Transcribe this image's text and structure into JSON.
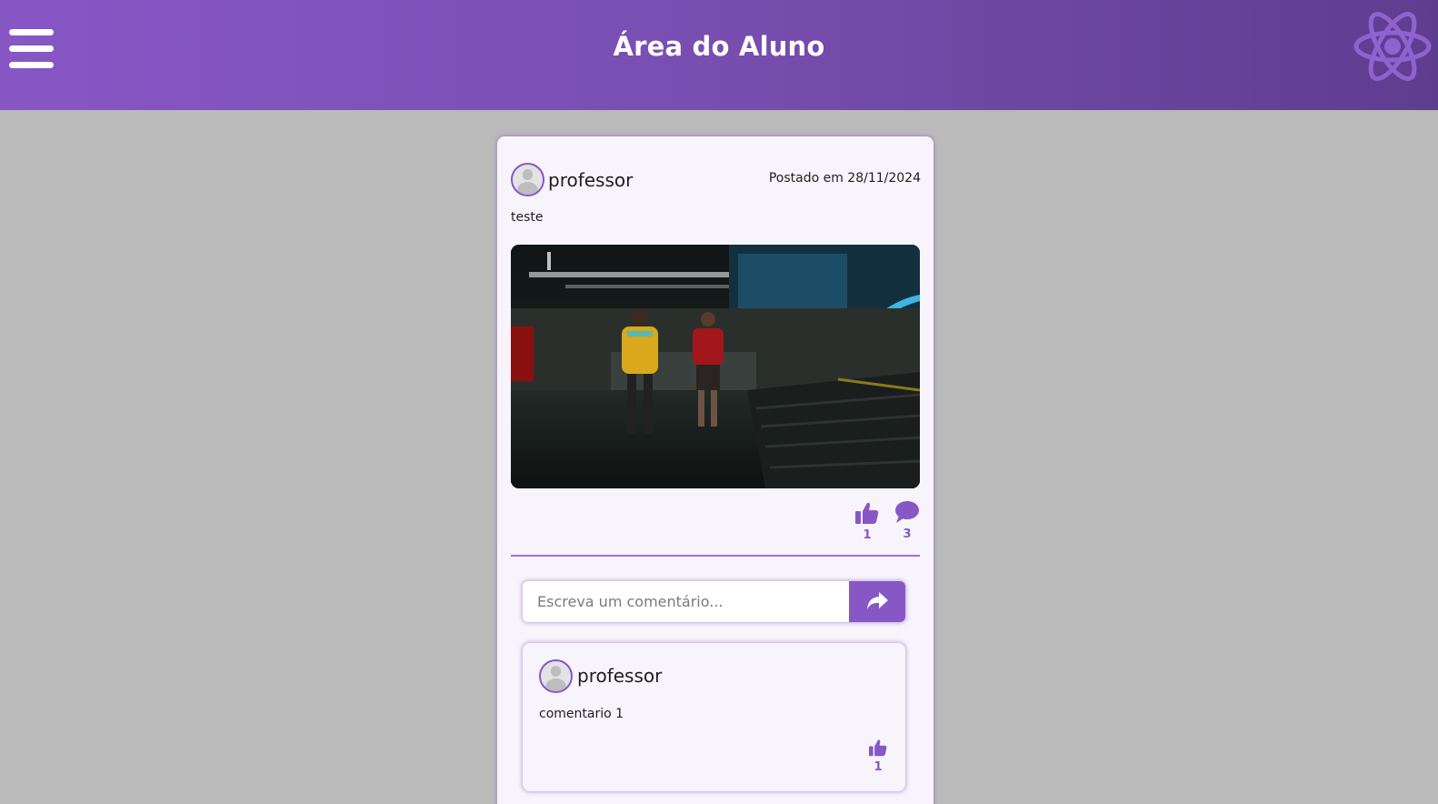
{
  "header": {
    "title": "Área do Aluno",
    "menu_icon": "hamburger-menu-icon",
    "logo_icon": "atom-icon"
  },
  "post": {
    "author": "professor",
    "date": "Postado em 28/11/2024",
    "text": "teste",
    "image_alt": "post-image",
    "likes": "1",
    "comments": "3",
    "like_icon": "thumbs-up-icon",
    "comment_icon": "comment-bubble-icon"
  },
  "comment_form": {
    "placeholder": "Escreva um comentário...",
    "send_icon": "share-arrow-icon"
  },
  "comments": [
    {
      "author": "professor",
      "text": "comentario 1",
      "likes": "1"
    }
  ],
  "colors": {
    "accent": "#8757c6",
    "header_start": "#8757c6",
    "header_end": "#5f3d8e",
    "background": "#bababa",
    "card": "#f7f4fb"
  }
}
